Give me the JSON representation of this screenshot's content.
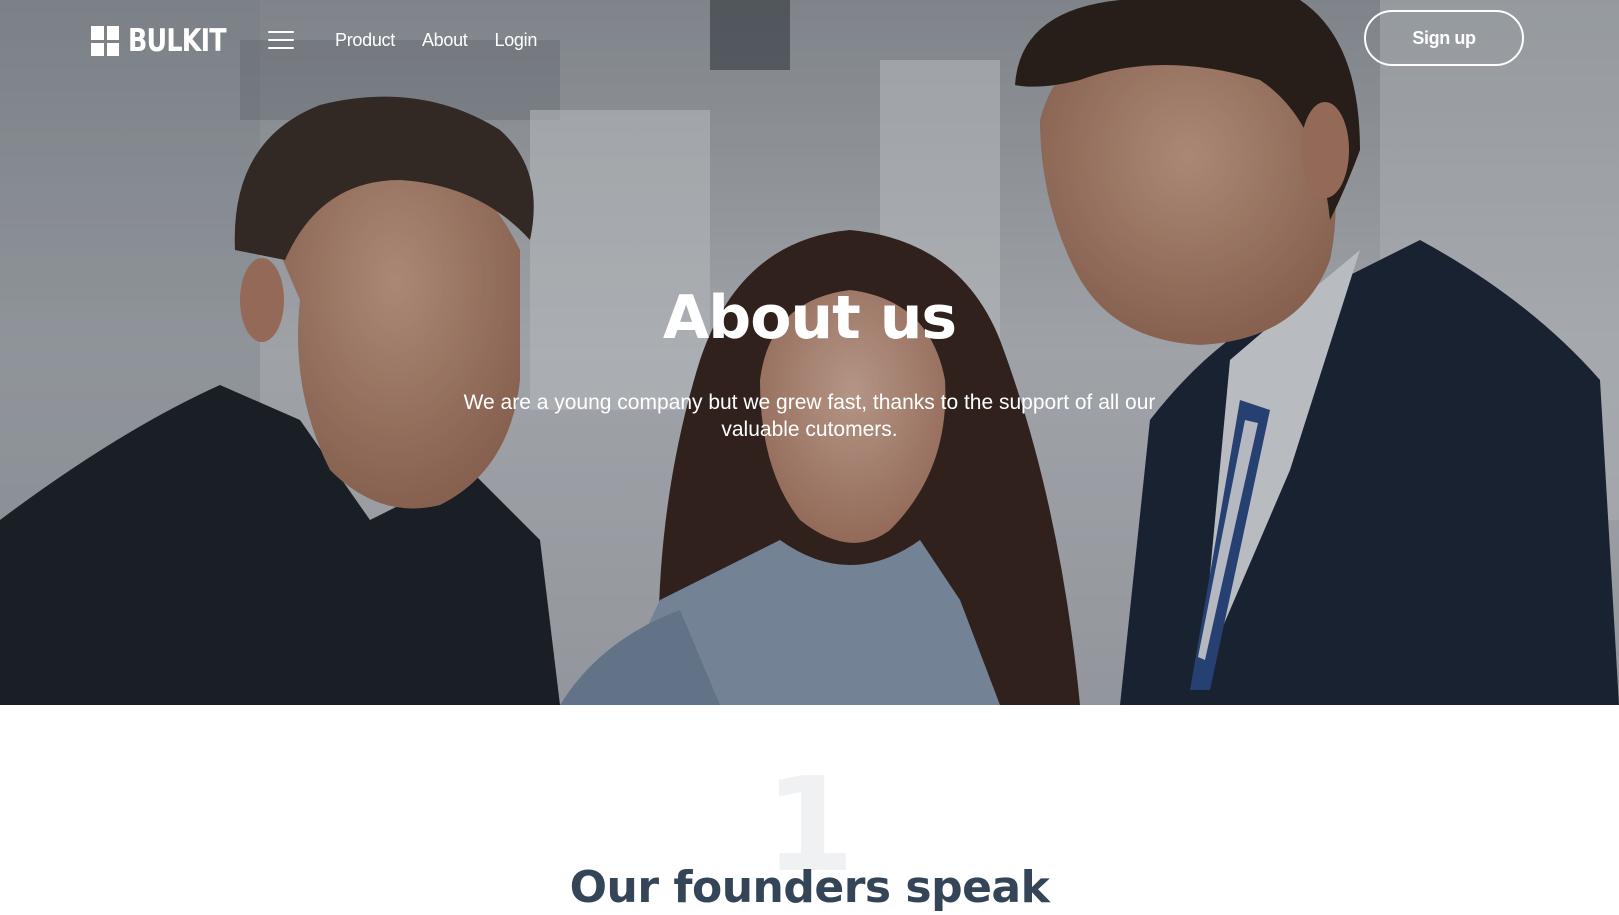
{
  "nav": {
    "logo_text": "BULKIT",
    "links": [
      {
        "label": "Product"
      },
      {
        "label": "About"
      },
      {
        "label": "Login"
      }
    ],
    "signup_label": "Sign up"
  },
  "hero": {
    "title": "About us",
    "subtitle": "We are a young company but we grew fast, thanks to the support of all our valuable cutomers."
  },
  "section": {
    "number": "1",
    "title": "Our founders speak"
  },
  "colors": {
    "nav_text": "#ffffff",
    "section_title": "#354558",
    "big_number": "#f0f1f3"
  }
}
